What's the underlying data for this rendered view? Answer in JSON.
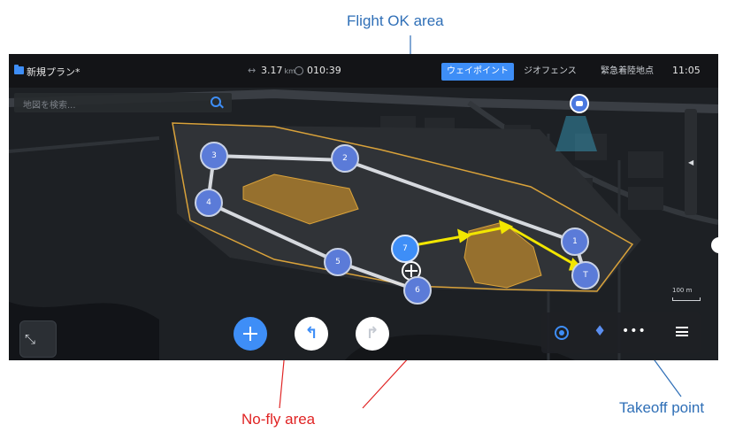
{
  "annotations": {
    "flight_ok": "Flight OK area",
    "no_fly": "No-fly area",
    "takeoff": "Takeoff point",
    "colors": {
      "flight_ok": "#2f6fb7",
      "no_fly": "#e02424",
      "takeoff": "#2f6fb7"
    }
  },
  "header": {
    "plan_title": "新規プラン*",
    "distance_value": "3.17",
    "distance_unit": "km",
    "flight_time": "010:39",
    "tabs": [
      {
        "label": "ウェイポイント",
        "active": true
      },
      {
        "label": "ジオフェンス",
        "active": false
      },
      {
        "label": "緊急着陸地点",
        "active": false
      }
    ],
    "clock": "11:05"
  },
  "search": {
    "placeholder": "地図を検索..."
  },
  "map": {
    "waypoints": [
      {
        "label": "1"
      },
      {
        "label": "2"
      },
      {
        "label": "3"
      },
      {
        "label": "4"
      },
      {
        "label": "5"
      },
      {
        "label": "6"
      },
      {
        "label": "7",
        "active": true
      },
      {
        "label": "T",
        "takeoff": true
      }
    ],
    "scale_label": "100 m",
    "colors": {
      "accent": "#3e8ef7",
      "geofence": "#d9a23a",
      "no_fly_fill": "#b8862c",
      "route_arrow": "#f2e600"
    }
  },
  "controls": {
    "icons": [
      "folder-icon",
      "search-icon",
      "drone-icon",
      "plus-icon",
      "undo-icon",
      "redo-icon",
      "locate-icon",
      "compass-icon",
      "more-icon",
      "menu-icon",
      "collapse-icon"
    ]
  }
}
